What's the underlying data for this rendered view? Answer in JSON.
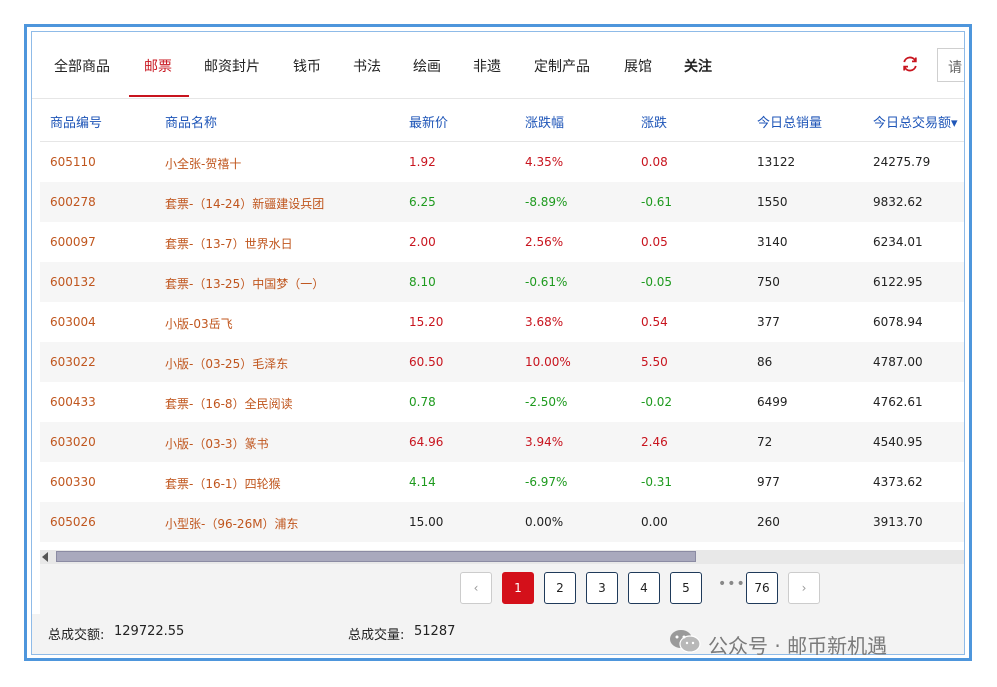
{
  "tabs": [
    {
      "label": "全部商品"
    },
    {
      "label": "邮票"
    },
    {
      "label": "邮资封片"
    },
    {
      "label": "钱币"
    },
    {
      "label": "书法"
    },
    {
      "label": "绘画"
    },
    {
      "label": "非遗"
    },
    {
      "label": "定制产品"
    },
    {
      "label": "展馆"
    },
    {
      "label": "关注"
    }
  ],
  "search": {
    "text": "请"
  },
  "table": {
    "headers": [
      "商品编号",
      "商品名称",
      "最新价",
      "涨跌幅",
      "涨跌",
      "今日总销量",
      "今日总交易额▾"
    ],
    "rows": [
      {
        "code": "605110",
        "name": "小全张-贺禧十",
        "price": "1.92",
        "pct": "4.35%",
        "chg": "0.08",
        "vol": "13122",
        "amount": "24275.79",
        "trend": "up"
      },
      {
        "code": "600278",
        "name": "套票-（14-24）新疆建设兵团",
        "price": "6.25",
        "pct": "-8.89%",
        "chg": "-0.61",
        "vol": "1550",
        "amount": "9832.62",
        "trend": "down"
      },
      {
        "code": "600097",
        "name": "套票-（13-7）世界水日",
        "price": "2.00",
        "pct": "2.56%",
        "chg": "0.05",
        "vol": "3140",
        "amount": "6234.01",
        "trend": "up"
      },
      {
        "code": "600132",
        "name": "套票-（13-25）中国梦（一）",
        "price": "8.10",
        "pct": "-0.61%",
        "chg": "-0.05",
        "vol": "750",
        "amount": "6122.95",
        "trend": "down"
      },
      {
        "code": "603004",
        "name": "小版-03岳飞",
        "price": "15.20",
        "pct": "3.68%",
        "chg": "0.54",
        "vol": "377",
        "amount": "6078.94",
        "trend": "up"
      },
      {
        "code": "603022",
        "name": "小版-（03-25）毛泽东",
        "price": "60.50",
        "pct": "10.00%",
        "chg": "5.50",
        "vol": "86",
        "amount": "4787.00",
        "trend": "up"
      },
      {
        "code": "600433",
        "name": "套票-（16-8）全民阅读",
        "price": "0.78",
        "pct": "-2.50%",
        "chg": "-0.02",
        "vol": "6499",
        "amount": "4762.61",
        "trend": "down"
      },
      {
        "code": "603020",
        "name": "小版-（03-3）篆书",
        "price": "64.96",
        "pct": "3.94%",
        "chg": "2.46",
        "vol": "72",
        "amount": "4540.95",
        "trend": "up"
      },
      {
        "code": "600330",
        "name": "套票-（16-1）四轮猴",
        "price": "4.14",
        "pct": "-6.97%",
        "chg": "-0.31",
        "vol": "977",
        "amount": "4373.62",
        "trend": "down"
      },
      {
        "code": "605026",
        "name": "小型张-（96-26M）浦东",
        "price": "15.00",
        "pct": "0.00%",
        "chg": "0.00",
        "vol": "260",
        "amount": "3913.70",
        "trend": "flat"
      }
    ]
  },
  "pagination": {
    "pages": [
      "1",
      "2",
      "3",
      "4",
      "5"
    ],
    "ellipsis": "•••",
    "last": "76",
    "prev": "‹",
    "next": "›"
  },
  "footer": {
    "total_amount_label": "总成交额:",
    "total_amount_value": "129722.55",
    "total_volume_label": "总成交量:",
    "total_volume_value": "51287"
  },
  "watermark": {
    "text": "公众号 · 邮币新机遇"
  },
  "colors": {
    "accent_red": "#c8141e",
    "code_orange": "#c0561e",
    "up_red": "#c8141e",
    "down_green": "#1e9a1e",
    "header_blue": "#1f56b8"
  },
  "icons": {
    "refresh": "refresh-icon",
    "chat": "wechat-icon"
  }
}
